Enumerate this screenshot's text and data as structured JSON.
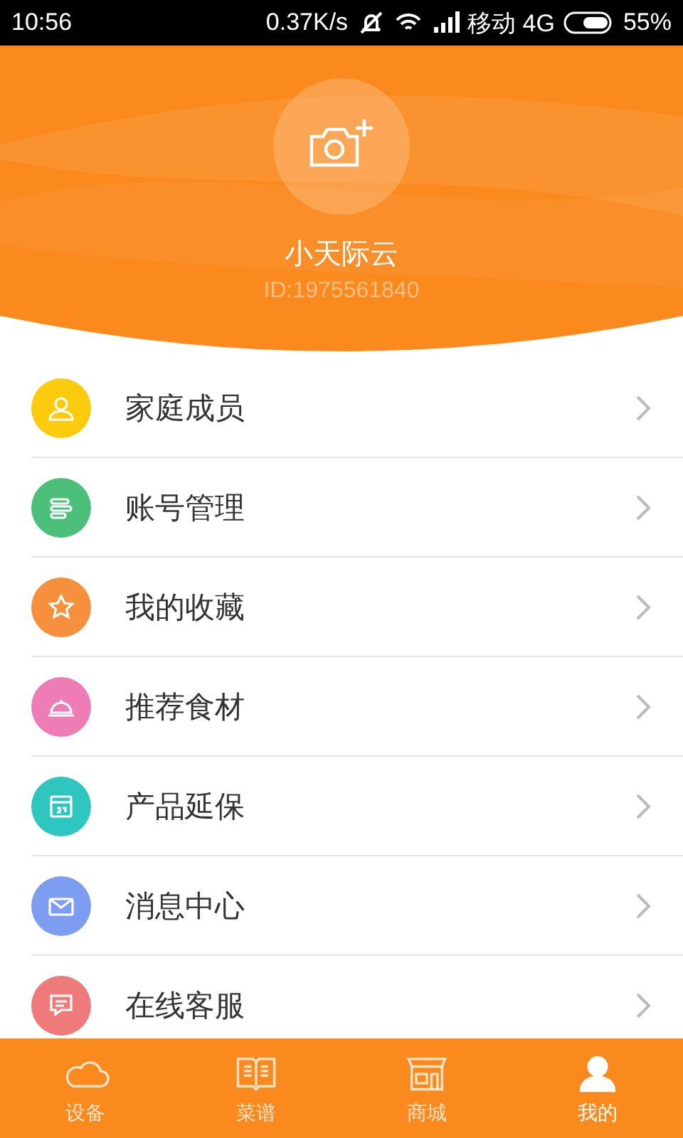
{
  "status_bar": {
    "time": "10:56",
    "speed": "0.37K/s",
    "carrier": "移动 4G",
    "battery": "55%"
  },
  "profile": {
    "name": "小天际云",
    "id": "ID:1975561840"
  },
  "menu": [
    {
      "label": "家庭成员",
      "kind": "person",
      "color": "#fdcb0d"
    },
    {
      "label": "账号管理",
      "kind": "lines",
      "color": "#4cc07a"
    },
    {
      "label": "我的收藏",
      "kind": "star",
      "color": "#f6903c"
    },
    {
      "label": "推荐食材",
      "kind": "dish",
      "color": "#ee7db6"
    },
    {
      "label": "产品延保",
      "kind": "calendar",
      "color": "#2fc6c0"
    },
    {
      "label": "消息中心",
      "kind": "mail",
      "color": "#7d9ef0"
    },
    {
      "label": "在线客服",
      "kind": "chat",
      "color": "#ee7a7a"
    }
  ],
  "tabs": [
    {
      "label": "设备",
      "kind": "cloud",
      "selected": false
    },
    {
      "label": "菜谱",
      "kind": "book",
      "selected": false
    },
    {
      "label": "商城",
      "kind": "shop",
      "selected": false
    },
    {
      "label": "我的",
      "kind": "user",
      "selected": true
    }
  ]
}
